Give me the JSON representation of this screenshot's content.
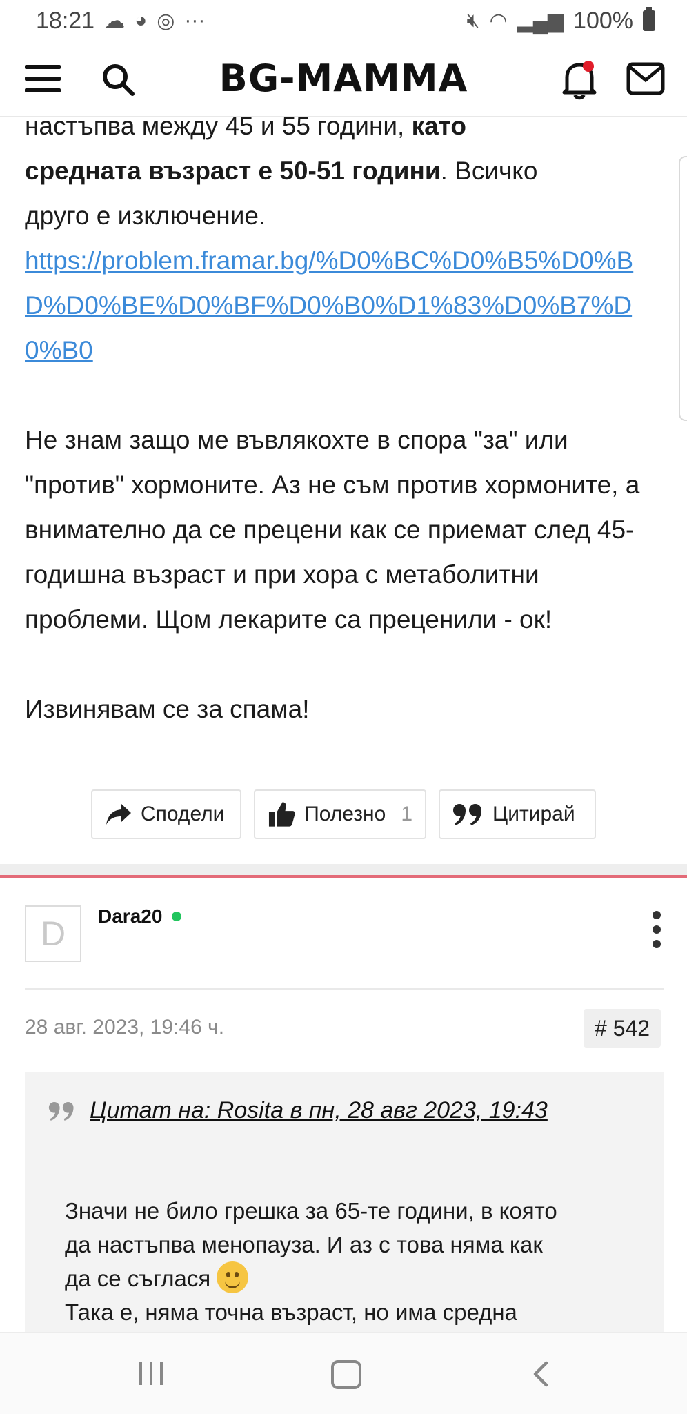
{
  "status": {
    "time": "18:21",
    "battery": "100%",
    "more": "···"
  },
  "app": {
    "logo": "BG-MAMMA"
  },
  "post_top": {
    "line1_normal": "настъпва между 45 и 55 години, ",
    "line1_bold": "като",
    "line2_bold": "средната възраст е 50-51 години",
    "line2_normal": ". Всичко",
    "line3": "друго е изключение.",
    "link": "https://problem.framar.bg/%D0%BC%D0%B5%D0%BD%D0%BE%D0%BF%D0%B0%D1%83%D0%B7%D0%B0",
    "paragraph2": "Не знам защо ме въвлякохте в спора \"за\" или \"против\" хормоните. Аз не съм против хормоните, а внимателно да се прецени как се приемат след 45-годишна възраст и при хора с метаболитни проблеми. Щом лекарите са преценили - ок!",
    "paragraph3": "Извинявам се за спама!"
  },
  "actions": {
    "share": "Сподели",
    "useful": "Полезно",
    "useful_count": "1",
    "quote": "Цитирай"
  },
  "post2": {
    "avatar_letter": "D",
    "username": "Dara20",
    "date": "28 авг. 2023, 19:46 ч.",
    "number": "# 542",
    "quote_title": "Цитат на: Rosita в пн, 28 авг 2023, 19:43",
    "quote_line1": "Значи не било грешка за 65-те години, в която",
    "quote_line2": "да настъпва менопауза. И аз с това няма как",
    "quote_line3": "да се съглася",
    "quote_line4": "Така е, няма точна възраст, но има средна"
  }
}
